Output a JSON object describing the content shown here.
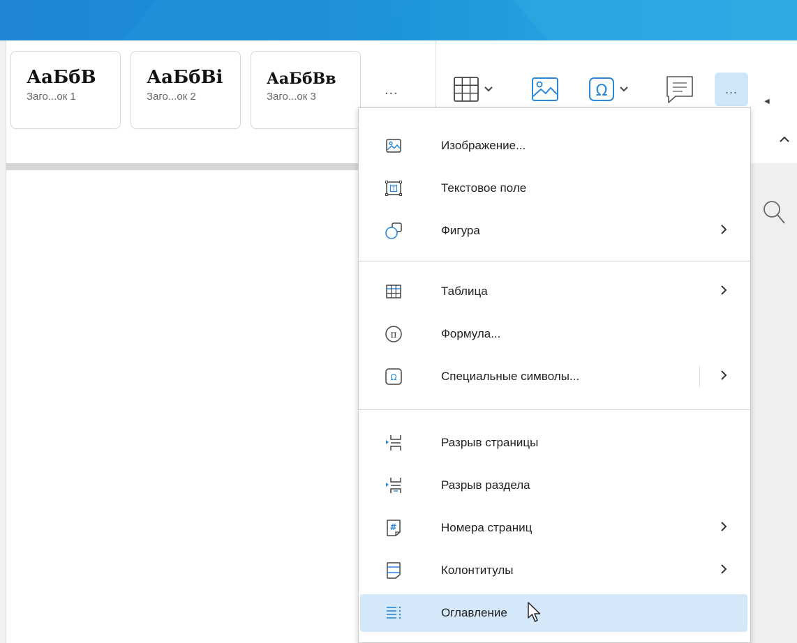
{
  "styles_gallery": {
    "cards": [
      {
        "preview": "АаБбВ",
        "name": "Заго...ок 1"
      },
      {
        "preview": "АаБбВі",
        "name": "Заго...ок 2"
      },
      {
        "preview": "АаБбВв",
        "name": "Заго...ок 3"
      }
    ],
    "more_label": "..."
  },
  "toolbar": {
    "more_label": "...",
    "buttons": [
      {
        "icon": "table-icon",
        "has_dropdown": true
      },
      {
        "icon": "image-icon",
        "has_dropdown": false
      },
      {
        "icon": "omega-icon",
        "has_dropdown": true
      },
      {
        "icon": "comment-icon",
        "has_dropdown": false
      },
      {
        "icon": "more-icon",
        "active": true
      }
    ]
  },
  "insert_menu": {
    "groups": [
      [
        {
          "label": "Изображение...",
          "icon": "image-icon",
          "submenu": false
        },
        {
          "label": "Текстовое поле",
          "icon": "text-box-icon",
          "submenu": false
        },
        {
          "label": "Фигура",
          "icon": "shapes-icon",
          "submenu": true
        }
      ],
      [
        {
          "label": "Таблица",
          "icon": "table-icon",
          "submenu": true
        },
        {
          "label": "Формула...",
          "icon": "pi-icon",
          "submenu": false
        },
        {
          "label": "Специальные символы...",
          "icon": "omega-icon",
          "submenu": true,
          "split": true
        }
      ],
      [
        {
          "label": "Разрыв страницы",
          "icon": "page-break-icon",
          "submenu": false
        },
        {
          "label": "Разрыв раздела",
          "icon": "section-break-icon",
          "submenu": false
        },
        {
          "label": "Номера страниц",
          "icon": "page-numbers-icon",
          "submenu": true
        },
        {
          "label": "Колонтитулы",
          "icon": "header-footer-icon",
          "submenu": true
        },
        {
          "label": "Оглавление",
          "icon": "table-of-contents-icon",
          "submenu": false,
          "hovered": true
        }
      ]
    ]
  },
  "colors": {
    "accent": "#1f86d6",
    "hover": "#d4e8f9",
    "icon_blue": "#2b87d8"
  }
}
